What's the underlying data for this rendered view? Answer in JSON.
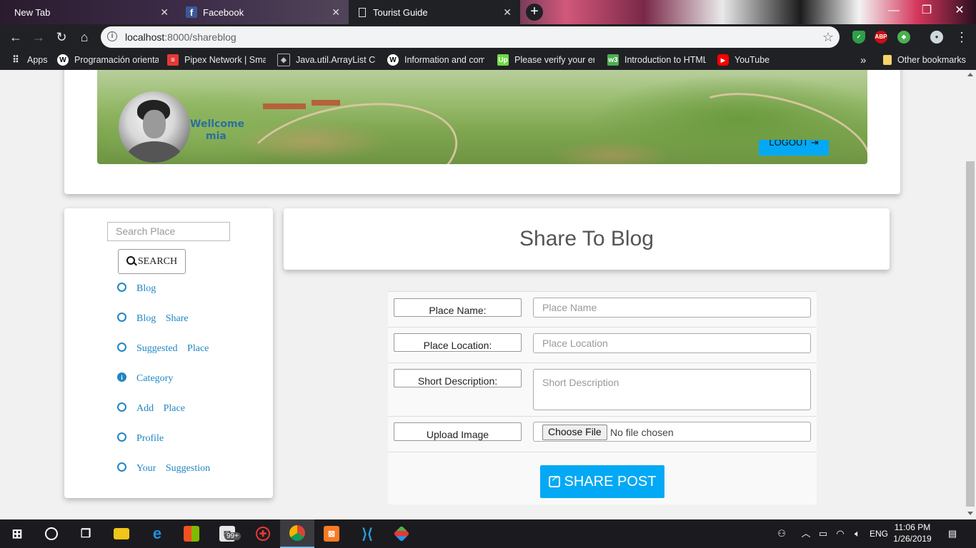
{
  "browser": {
    "tabs": [
      {
        "label": "New Tab"
      },
      {
        "label": "Facebook"
      },
      {
        "label": "Tourist Guide"
      }
    ],
    "url_host": "localhost",
    "url_path": ":8000/shareblog",
    "bookmarks": [
      {
        "label": "Apps"
      },
      {
        "label": "Programación orienta"
      },
      {
        "label": "Pipex Network | Smar"
      },
      {
        "label": "Java.util.ArrayList Cla"
      },
      {
        "label": "Information and com"
      },
      {
        "label": "Please verify your em"
      },
      {
        "label": "Introduction to HTML"
      },
      {
        "label": "YouTube"
      }
    ],
    "more_bookmarks": "»",
    "other_bookmarks": "Other bookmarks",
    "ext_abp": "ABP"
  },
  "header": {
    "welcome_line1": "Wellcome",
    "welcome_line2": "mia",
    "logout_label": "LOGOUT"
  },
  "sidebar": {
    "search_placeholder": "Search Place",
    "search_button": "SEARCH",
    "items": [
      {
        "label": "Blog"
      },
      {
        "label": "Blog Share"
      },
      {
        "label": "Suggested Place"
      },
      {
        "label": "Category"
      },
      {
        "label": "Add Place"
      },
      {
        "label": "Profile"
      },
      {
        "label": "Your Suggestion"
      }
    ]
  },
  "main": {
    "title": "Share To Blog",
    "form": {
      "place_name_label": "Place Name:",
      "place_name_placeholder": "Place Name",
      "place_location_label": "Place Location:",
      "place_location_placeholder": "Place Location",
      "short_description_label": "Short Description:",
      "short_description_placeholder": "Short Description",
      "upload_image_label": "Upload Image",
      "choose_file_label": "Choose File",
      "no_file_text": "No file chosen",
      "share_button": "SHARE POST"
    }
  },
  "taskbar": {
    "badge_count": "99+",
    "language": "ENG",
    "time": "11:06 PM",
    "date": "1/26/2019"
  },
  "colors": {
    "accent": "#03a9f4",
    "link": "#1f86c4"
  }
}
